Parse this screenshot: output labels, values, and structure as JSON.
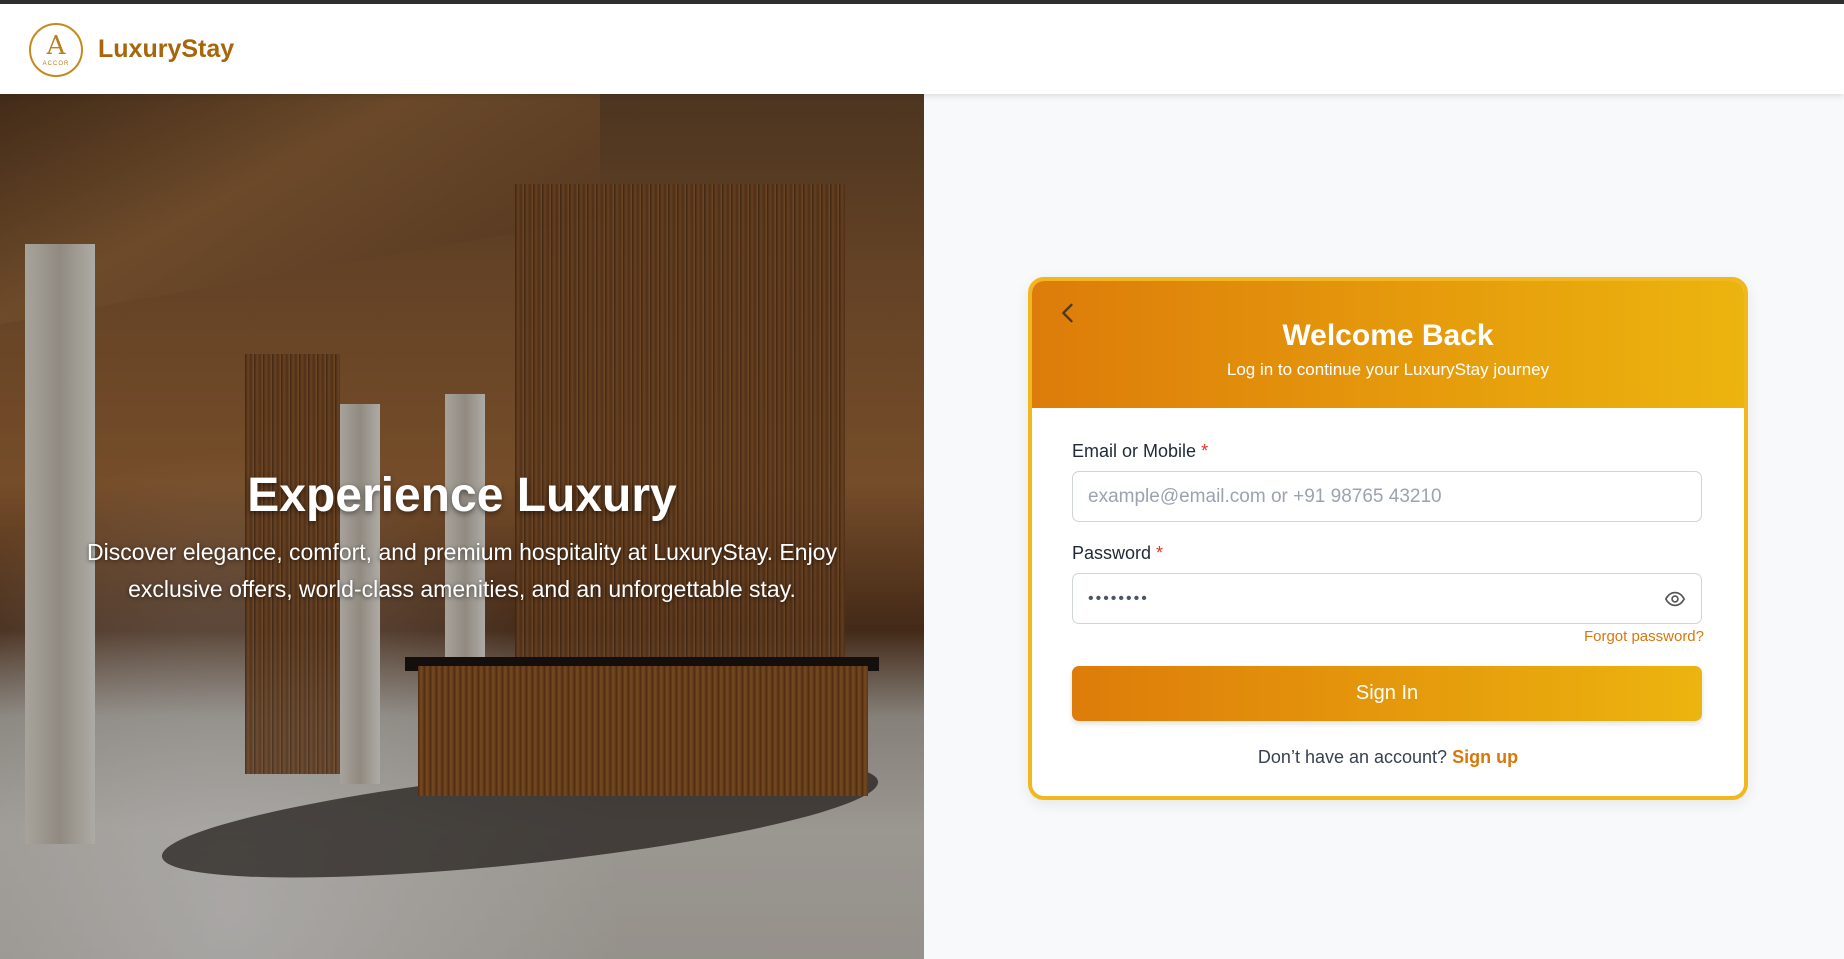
{
  "brand": {
    "name": "LuxuryStay",
    "logo_letter": "A",
    "logo_sub": "ACCOR"
  },
  "hero": {
    "title": "Experience Luxury",
    "text": "Discover elegance, comfort, and premium hospitality at LuxuryStay. Enjoy exclusive offers, world-class amenities, and an unforgettable stay."
  },
  "login": {
    "title": "Welcome Back",
    "subtitle": "Log in to continue your LuxuryStay journey",
    "email_label": "Email or Mobile",
    "email_placeholder": "example@email.com or +91 98765 43210",
    "password_label": "Password",
    "password_value": "••••••••",
    "required_mark": "*",
    "forgot": "Forgot password?",
    "signin": "Sign In",
    "no_account": "Don’t have an account?",
    "signup": "Sign up"
  },
  "colors": {
    "accent_start": "#dd7c0a",
    "accent_end": "#ecb40e",
    "border": "#f2b71f",
    "brand": "#a8650a"
  },
  "icons": {
    "back": "chevron-left-icon",
    "eye": "eye-icon"
  }
}
